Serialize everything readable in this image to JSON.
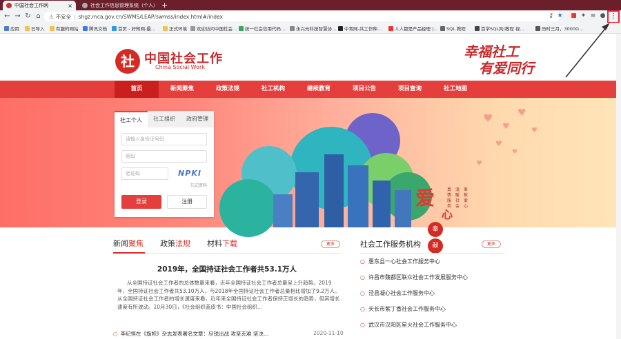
{
  "browser": {
    "tabs": [
      {
        "title": "中国社会工作网",
        "close": "×"
      },
      {
        "title": "社会工作信息管理系统（个人）",
        "close": "×"
      }
    ],
    "new_tab": "+",
    "nav": {
      "back": "←",
      "forward": "→",
      "reload": "↻",
      "home": "⌂"
    },
    "address": {
      "warning": "不安全",
      "url": "shgz.mca.gov.cn/SWMS/LEAP/swmss/index.html#/index"
    },
    "menu": "⋮",
    "bookmarks": [
      "应用",
      "已导入",
      "有趣的网站",
      "腾讯文档",
      "首页 - 好知网-最…",
      "正式环境",
      "欢迎访问中国社会…",
      "统一社会信用代码…",
      "永兴元科技智慧协…",
      "中青网-共工作种…",
      "人人都是产品经理 |…",
      "SQL 教程",
      "首学SQL风(教程 视…",
      "历时三月，3000G…"
    ]
  },
  "site": {
    "logo_mark": "社",
    "logo_cn": "中国社会工作",
    "logo_en": "China Social Work",
    "slogan_1": "幸福社工",
    "slogan_2": "有爱同行",
    "nav": [
      "首页",
      "新闻聚焦",
      "政策法规",
      "社工机构",
      "继续教育",
      "项目公告",
      "项目查询",
      "社工地图"
    ],
    "login": {
      "tabs": [
        "社工个人",
        "社工组织",
        "政府管理"
      ],
      "id_placeholder": "请输入身份证号码",
      "password_placeholder": "密码",
      "captcha_placeholder": "验证码",
      "captcha_text": "NPKI",
      "forgot": "忘记密码",
      "login_btn": "登录",
      "register_btn": "注册"
    },
    "banner": {
      "ai": "爱",
      "xin": "心",
      "feng": "奉",
      "xian": "献",
      "v1": "真情服务",
      "v2": "温暖社会",
      "v3": "奉献爱心"
    },
    "news": {
      "tabs": [
        {
          "a": "新闻",
          "b": "聚焦"
        },
        {
          "a": "政策",
          "b": "法规"
        },
        {
          "a": "材料",
          "b": "下载"
        }
      ],
      "more": "更多",
      "headline": "2019年，全国持证社会工作者共53.1万人",
      "summary": "从全国持证社会工作者的总体数量来看，近年全国持证社会工作者总量呈上升趋势。2019年，全国持证社会工作者共53.10万人，与2018年全国持证社会工作者总量相比增加了9.2万人。从全国持证社会工作者的增长速度来看，近年来全国持证社会工作者保持正增长的趋势，但其增长速度有所波动。10月30日，《社会组织蓝皮书：中国社会组织…",
      "item": "李纪恒在《旗帜》杂志发表署名文章：尽锐出战 攻坚克难 坚决…",
      "item_date": "2020-11-10"
    },
    "orgs": {
      "title": "社会工作服务机构",
      "more": "更多",
      "items": [
        "惠东县一心社会工作服务中心",
        "许昌市魏都区联众社会工作发展服务中心",
        "泾县凝心社会工作服务中心",
        "天长市紫丁香社会工作服务中心",
        "武汉市汉阳区星火社会工作服务中心"
      ]
    }
  }
}
